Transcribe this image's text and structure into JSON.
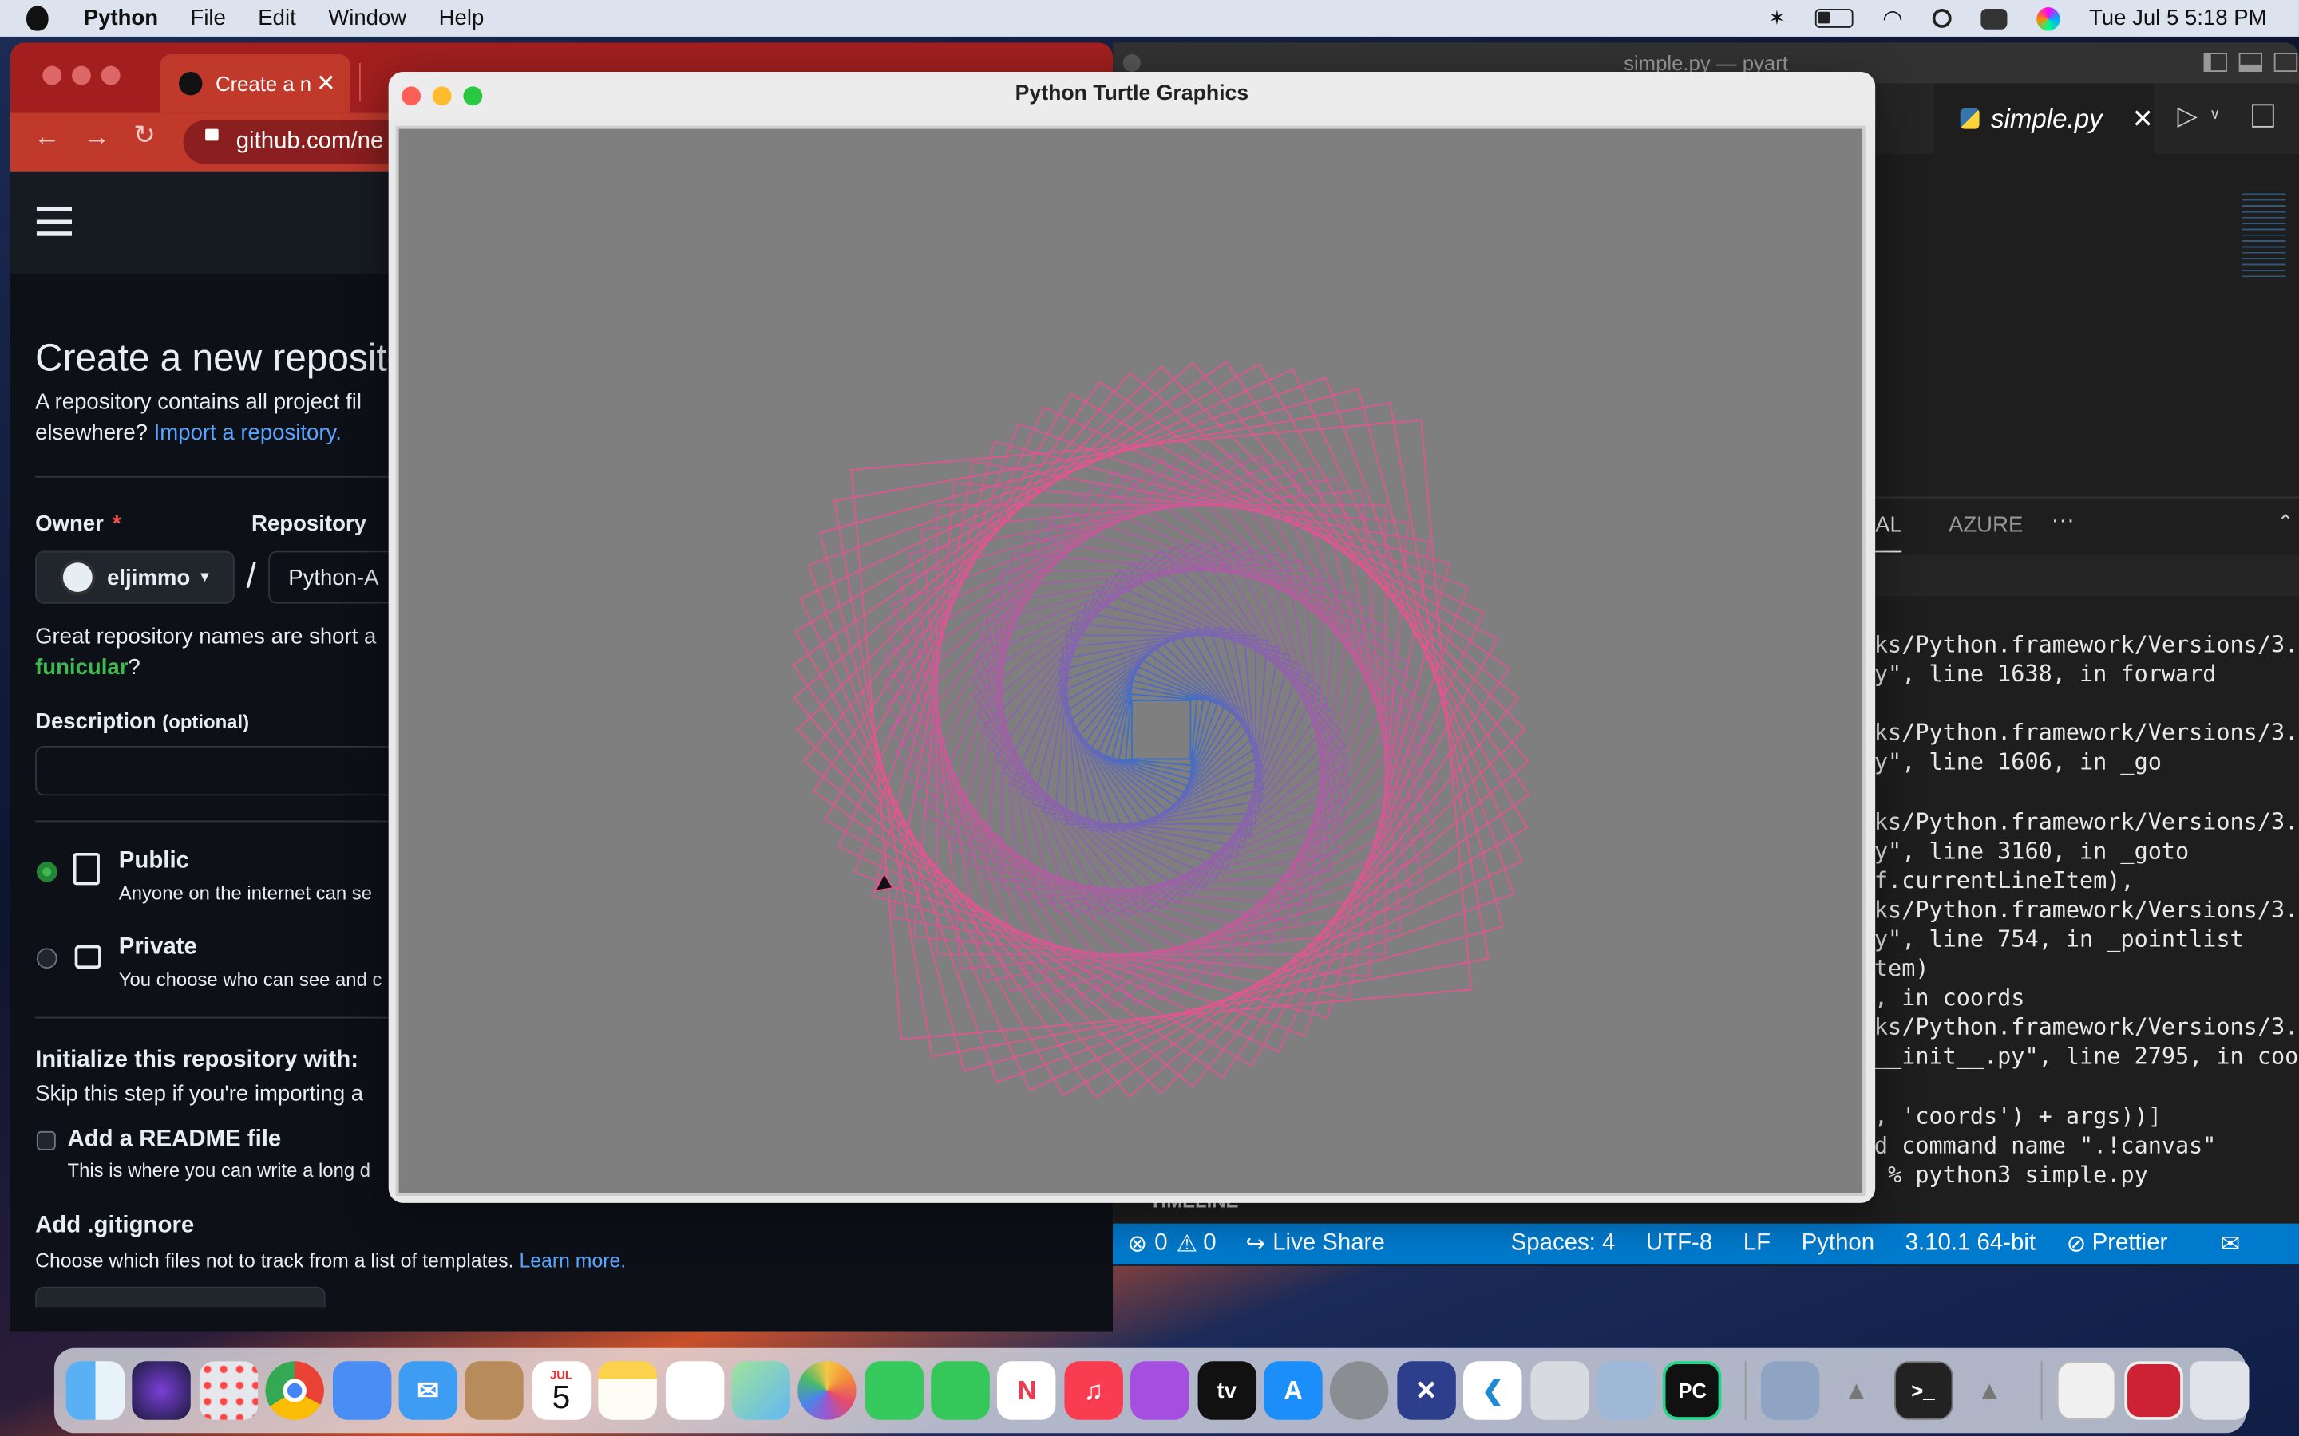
{
  "menubar": {
    "app": "Python",
    "items": [
      "File",
      "Edit",
      "Window",
      "Help"
    ],
    "clock": "Tue Jul 5  5:18 PM"
  },
  "browser": {
    "tab_title": "Create a n",
    "url": "github.com/ne",
    "page": {
      "heading": "Create a new reposito",
      "intro_line1": "A repository contains all project fil",
      "intro_line2": "elsewhere?",
      "import_link": "Import a repository.",
      "owner_label": "Owner",
      "required_mark": "*",
      "repo_label": "Repository",
      "owner_value": "eljimmo",
      "slash": "/",
      "repo_value": "Python-A",
      "names_hint": "Great repository names are short a",
      "suggestion": "funicular",
      "suggestion_end": "?",
      "description_label": "Description",
      "description_optional": "(optional)",
      "public_label": "Public",
      "public_desc": "Anyone on the internet can se",
      "private_label": "Private",
      "private_desc": "You choose who can see and c",
      "init_heading": "Initialize this repository with:",
      "init_hint": "Skip this step if you're importing a",
      "readme_label": "Add a README file",
      "readme_desc": "This is where you can write a long d",
      "gitignore_heading": "Add .gitignore",
      "gitignore_hint": "Choose which files not to track from a list of templates.",
      "learn_more": "Learn more."
    }
  },
  "vscode": {
    "window_title": "simple.py — pyart",
    "tab": "simple.py",
    "panel_tabs": [
      "AL",
      "AZURE",
      "···"
    ],
    "terminal_lines": [
      "rks/Python.framework/Versions/3.",
      "py\", line 1638, in forward",
      "",
      "rks/Python.framework/Versions/3.",
      "py\", line 1606, in _go",
      "",
      "rks/Python.framework/Versions/3.",
      "py\", line 3160, in _goto",
      "lf.currentLineItem),",
      "rks/Python.framework/Versions/3.",
      "py\", line 754, in _pointlist",
      "item)",
      "1, in coords",
      "rks/Python.framework/Versions/3.",
      "/__init__.py\", line 2795, in coo",
      "",
      "w, 'coords') + args))]",
      "id command name \".!canvas\"",
      "t % python3 simple.py"
    ],
    "timeline": "TIMELINE",
    "status": {
      "errors": "0",
      "warnings": "0",
      "live_share": "Live Share",
      "spaces": "Spaces: 4",
      "encoding": "UTF-8",
      "eol": "LF",
      "language": "Python",
      "interpreter": "3.10.1 64-bit",
      "prettier": "Prettier"
    }
  },
  "turtle": {
    "title": "Python Turtle Graphics"
  },
  "dock": {
    "calendar_month": "JUL",
    "calendar_day": "5",
    "tv_label": "tv",
    "pycharm_label": "PC",
    "apps": [
      "finder",
      "siri",
      "launchpad",
      "chrome",
      "safari",
      "mail",
      "contacts",
      "calendar",
      "notes",
      "reminders",
      "maps",
      "photos",
      "messages",
      "facetime",
      "news",
      "music",
      "podcasts",
      "tv",
      "appstore",
      "system-preferences",
      "xcode-like",
      "vscode",
      "preview",
      "virtualbox",
      "pycharm",
      "image-capture",
      "rocket",
      "terminal",
      "rocket-2",
      "documents",
      "gallery",
      "trash"
    ]
  },
  "colors": {
    "spiral_outer": "#e0578f",
    "spiral_inner": "#3a6fc8",
    "canvas_bg": "#7f7f7f",
    "vscode_status": "#007acc",
    "github_link": "#58a6ff"
  }
}
